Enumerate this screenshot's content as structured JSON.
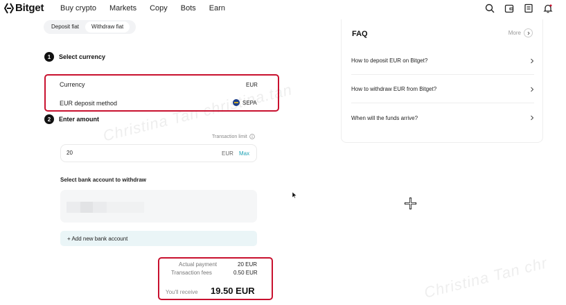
{
  "brand": {
    "name": "Bitget"
  },
  "nav": {
    "links": [
      "Buy crypto",
      "Markets",
      "Copy",
      "Bots",
      "Earn"
    ],
    "icons": [
      "search-icon",
      "wallet-icon",
      "orders-icon",
      "bell-icon"
    ]
  },
  "tabs": {
    "deposit": "Deposit fiat",
    "withdraw": "Withdraw fiat"
  },
  "step1": {
    "num": "1",
    "title": "Select currency",
    "currency_label": "Currency",
    "currency_value": "EUR",
    "method_label": "EUR deposit method",
    "method_value": "SEPA"
  },
  "step2": {
    "num": "2",
    "title": "Enter amount",
    "limit_label": "Transaction limit",
    "amount_value": "20",
    "amount_currency": "EUR",
    "max_label": "Max"
  },
  "bank": {
    "title": "Select bank account to withdraw",
    "add_label": "+ Add new bank account"
  },
  "summary": {
    "actual_label": "Actual payment",
    "actual_value": "20 EUR",
    "fees_label": "Transaction fees",
    "fees_value": "0.50 EUR",
    "receive_label": "You'll receive",
    "receive_value": "19.50 EUR"
  },
  "faq": {
    "title": "FAQ",
    "more": "More",
    "items": [
      "How to deposit EUR on Bitget?",
      "How to withdraw EUR from Bitget?",
      "When will the funds arrive?"
    ]
  },
  "watermark": "Christina Tan christina.tan",
  "watermark_partial": "Christina Tan chr",
  "colors": {
    "accent": "#1da2b4",
    "highlight": "#c8102e",
    "sepa_badge": "#1d3f8a"
  }
}
